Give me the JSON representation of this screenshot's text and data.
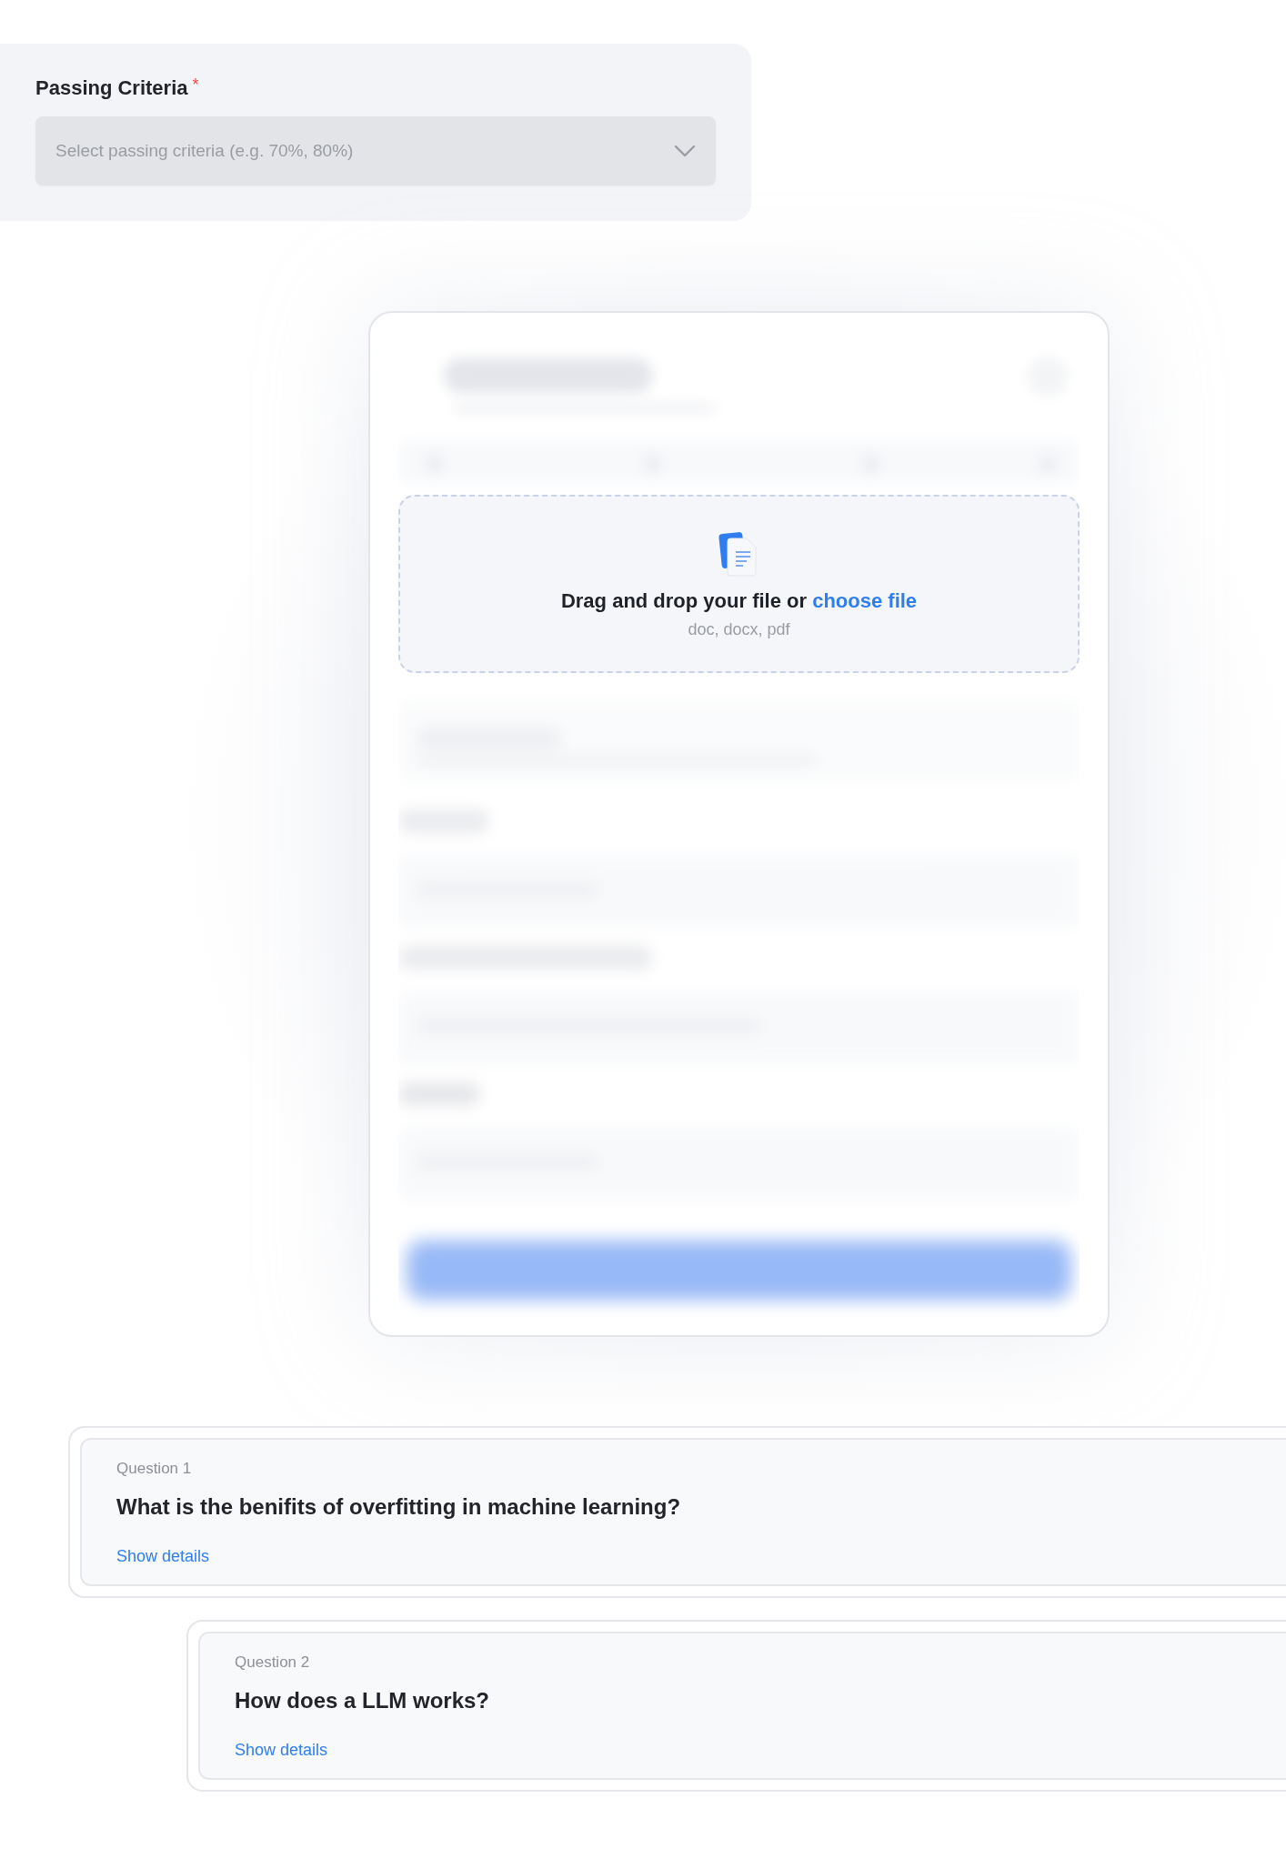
{
  "passing_criteria": {
    "label": "Passing Criteria",
    "required_mark": "*",
    "placeholder": "Select passing criteria (e.g. 70%, 80%)"
  },
  "upload": {
    "prompt": "Drag and drop your file or",
    "link": "choose file",
    "formats": "doc, docx, pdf"
  },
  "questions": [
    {
      "label": "Question 1",
      "text": "What is the benifits of overfitting in machine learning?",
      "action": "Show details"
    },
    {
      "label": "Question 2",
      "text": "How does a LLM works?",
      "action": "Show details"
    }
  ]
}
